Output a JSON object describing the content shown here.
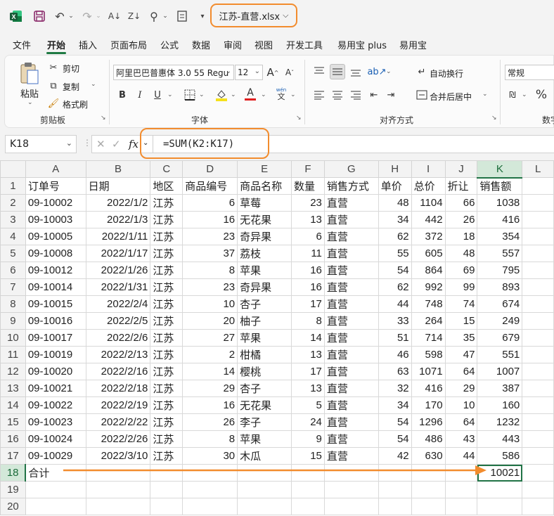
{
  "app": {
    "logo": "X",
    "file_title": "江苏-直营.xlsx"
  },
  "quick_access": [
    "save-icon",
    "undo-icon",
    "redo-icon",
    "sort-asc-icon",
    "sort-desc-icon",
    "search-icon",
    "form-icon",
    "customize-icon"
  ],
  "tabs": [
    "文件",
    "开始",
    "插入",
    "页面布局",
    "公式",
    "数据",
    "审阅",
    "视图",
    "开发工具",
    "易用宝 plus",
    "易用宝"
  ],
  "active_tab": "开始",
  "ribbon": {
    "clipboard": {
      "paste": "粘贴",
      "cut": "剪切",
      "copy": "复制",
      "format_painter": "格式刷",
      "title": "剪贴板"
    },
    "font": {
      "name": "阿里巴巴普惠体 3.0 55 Regu",
      "size": "12",
      "title": "字体",
      "bold": "B",
      "italic": "I",
      "underline": "U",
      "font_color_letter": "A",
      "wen": "wén",
      "wen2": "文"
    },
    "align": {
      "wrap": "自动换行",
      "merge": "合并后居中",
      "title": "对齐方式"
    },
    "number": {
      "format": "常规",
      "title": "数字",
      "percent": "%"
    }
  },
  "formula_bar": {
    "name_box": "K18",
    "fx": "fx",
    "formula": "=SUM(K2:K17)"
  },
  "columns": [
    "A",
    "B",
    "C",
    "D",
    "E",
    "F",
    "G",
    "H",
    "I",
    "J",
    "K",
    "L"
  ],
  "headers": [
    "订单号",
    "日期",
    "地区",
    "商品编号",
    "商品名称",
    "数量",
    "销售方式",
    "单价",
    "总价",
    "折让",
    "销售额"
  ],
  "rows": [
    [
      "09-10002",
      "2022/1/2",
      "江苏",
      "6",
      "草莓",
      "23",
      "直营",
      "48",
      "1104",
      "66",
      "1038"
    ],
    [
      "09-10003",
      "2022/1/3",
      "江苏",
      "16",
      "无花果",
      "13",
      "直营",
      "34",
      "442",
      "26",
      "416"
    ],
    [
      "09-10005",
      "2022/1/11",
      "江苏",
      "23",
      "奇异果",
      "6",
      "直营",
      "62",
      "372",
      "18",
      "354"
    ],
    [
      "09-10008",
      "2022/1/17",
      "江苏",
      "37",
      "荔枝",
      "11",
      "直营",
      "55",
      "605",
      "48",
      "557"
    ],
    [
      "09-10012",
      "2022/1/26",
      "江苏",
      "8",
      "苹果",
      "16",
      "直营",
      "54",
      "864",
      "69",
      "795"
    ],
    [
      "09-10014",
      "2022/1/31",
      "江苏",
      "23",
      "奇异果",
      "16",
      "直营",
      "62",
      "992",
      "99",
      "893"
    ],
    [
      "09-10015",
      "2022/2/4",
      "江苏",
      "10",
      "杏子",
      "17",
      "直营",
      "44",
      "748",
      "74",
      "674"
    ],
    [
      "09-10016",
      "2022/2/5",
      "江苏",
      "20",
      "柚子",
      "8",
      "直营",
      "33",
      "264",
      "15",
      "249"
    ],
    [
      "09-10017",
      "2022/2/6",
      "江苏",
      "27",
      "苹果",
      "14",
      "直营",
      "51",
      "714",
      "35",
      "679"
    ],
    [
      "09-10019",
      "2022/2/13",
      "江苏",
      "2",
      "柑橘",
      "13",
      "直营",
      "46",
      "598",
      "47",
      "551"
    ],
    [
      "09-10020",
      "2022/2/16",
      "江苏",
      "14",
      "樱桃",
      "17",
      "直营",
      "63",
      "1071",
      "64",
      "1007"
    ],
    [
      "09-10021",
      "2022/2/18",
      "江苏",
      "29",
      "杏子",
      "13",
      "直营",
      "32",
      "416",
      "29",
      "387"
    ],
    [
      "09-10022",
      "2022/2/19",
      "江苏",
      "16",
      "无花果",
      "5",
      "直营",
      "34",
      "170",
      "10",
      "160"
    ],
    [
      "09-10023",
      "2022/2/22",
      "江苏",
      "26",
      "李子",
      "24",
      "直营",
      "54",
      "1296",
      "64",
      "1232"
    ],
    [
      "09-10024",
      "2022/2/26",
      "江苏",
      "8",
      "苹果",
      "9",
      "直营",
      "54",
      "486",
      "43",
      "443"
    ],
    [
      "09-10029",
      "2022/3/10",
      "江苏",
      "30",
      "木瓜",
      "15",
      "直营",
      "42",
      "630",
      "44",
      "586"
    ]
  ],
  "total_row": {
    "label": "合计",
    "value": "10021"
  },
  "row_numbers": [
    "1",
    "2",
    "3",
    "4",
    "5",
    "6",
    "7",
    "8",
    "9",
    "10",
    "11",
    "12",
    "13",
    "14",
    "15",
    "16",
    "17",
    "18",
    "19",
    "20"
  ],
  "colors": {
    "excel_green": "#217346",
    "highlight_orange": "#f28c2e"
  }
}
